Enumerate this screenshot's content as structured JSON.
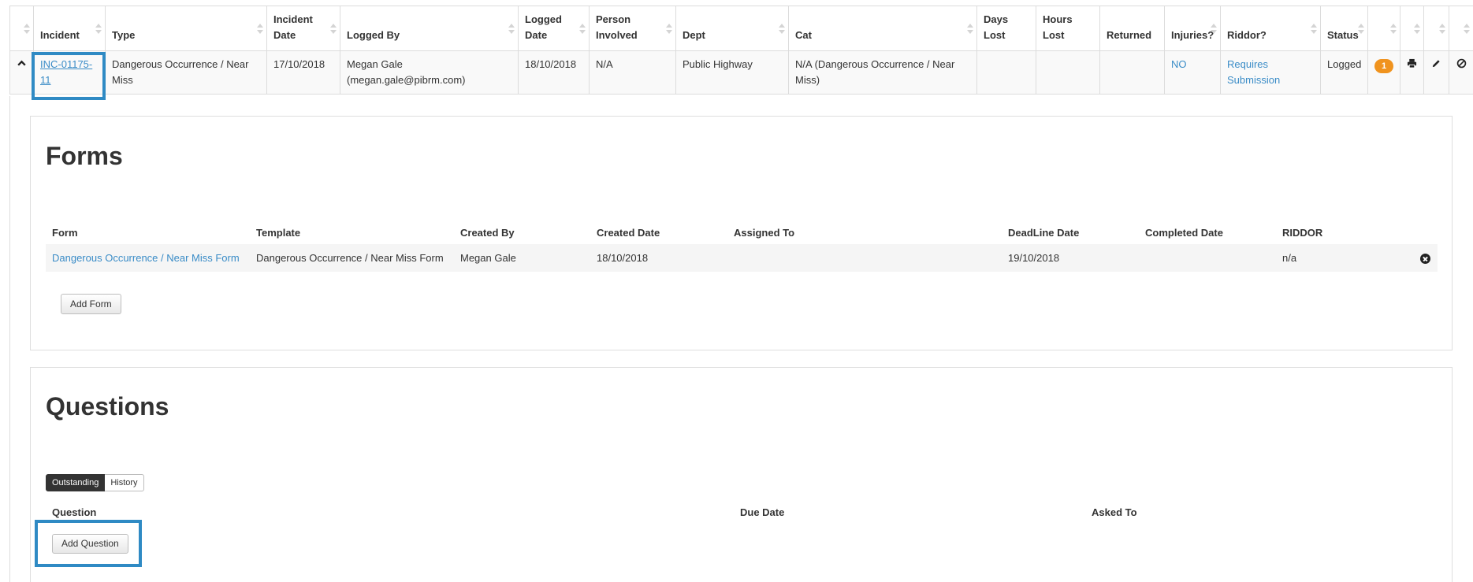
{
  "incident_table": {
    "headers": [
      "",
      "Incident",
      "Type",
      "Incident Date",
      "Logged By",
      "Logged Date",
      "Person Involved",
      "Dept",
      "Cat",
      "Days Lost",
      "Hours Lost",
      "Returned",
      "Injuries?",
      "Riddor?",
      "Status",
      "",
      "",
      "",
      ""
    ],
    "row": {
      "incident_id": "INC-01175-11",
      "type": "Dangerous Occurrence / Near Miss",
      "incident_date": "17/10/2018",
      "logged_by": "Megan Gale (megan.gale@pibrm.com)",
      "logged_date": "18/10/2018",
      "person_involved": "N/A",
      "dept": "Public Highway",
      "cat": "N/A (Dangerous Occurrence / Near Miss)",
      "days_lost": "",
      "hours_lost": "",
      "returned": "",
      "injuries": "NO",
      "riddor": "Requires Submission",
      "status": "Logged",
      "badge_count": "1"
    },
    "icons": {
      "expand": "chevron-up-icon",
      "print": "print-icon",
      "edit": "pencil-icon",
      "cancel": "ban-icon"
    }
  },
  "forms": {
    "title": "Forms",
    "headers": [
      "Form",
      "Template",
      "Created By",
      "Created Date",
      "Assigned To",
      "DeadLine Date",
      "Completed Date",
      "RIDDOR",
      ""
    ],
    "rows": [
      {
        "form": "Dangerous Occurrence / Near Miss Form",
        "template": "Dangerous Occurrence / Near Miss Form",
        "created_by": "Megan Gale",
        "created_date": "18/10/2018",
        "assigned_to": "",
        "deadline_date": "19/10/2018",
        "completed_date": "",
        "riddor": "n/a"
      }
    ],
    "add_button": "Add Form"
  },
  "questions": {
    "title": "Questions",
    "tabs": [
      "Outstanding",
      "History"
    ],
    "headers": [
      "Question",
      "Due Date",
      "Asked To"
    ],
    "add_button": "Add Question"
  },
  "colors": {
    "link": "#3a8cc7",
    "highlight": "#2f8ac4",
    "badge": "#f0931e"
  }
}
